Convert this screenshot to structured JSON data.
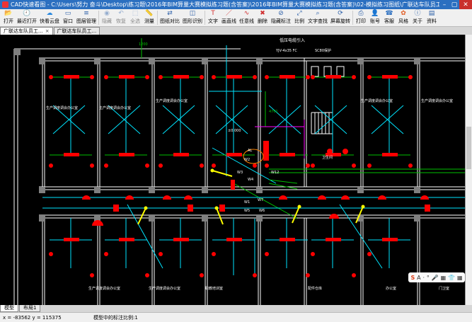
{
  "window": {
    "title": "CAD快速看图 - C:\\Users\\努力 奋斗\\Desktop\\练习题\\2016年BIM算量大赛模拟练习题(含答案)\\2016年BIM算量大赛模拟练习题(含答案)\\02-模拟练习图纸\\广联达车队员工宿舍楼--安装--CAD最终版\\广联达..."
  },
  "toolbar": {
    "items": [
      {
        "label": "打开",
        "icon": "folder-icon"
      },
      {
        "label": "最近打开",
        "icon": "clock-icon"
      },
      {
        "label": "快看云盘",
        "icon": "cloud-icon"
      },
      {
        "label": "窗口",
        "icon": "window-icon"
      },
      {
        "label": "图层管理",
        "icon": "layers-icon"
      },
      {
        "label": "隐藏",
        "icon": "eye-icon",
        "disabled": true
      },
      {
        "label": "恢复",
        "icon": "undo-icon",
        "disabled": true
      },
      {
        "label": "全选",
        "icon": "select-all-icon",
        "disabled": true
      },
      {
        "label": "测量",
        "icon": "ruler-icon"
      },
      {
        "label": "图纸对比",
        "icon": "compare-icon"
      },
      {
        "label": "图形识别",
        "icon": "recognize-icon"
      },
      {
        "label": "文字",
        "icon": "text-icon"
      },
      {
        "label": "画直线",
        "icon": "line-icon"
      },
      {
        "label": "任意线",
        "icon": "freehand-icon"
      },
      {
        "label": "删除",
        "icon": "delete-icon"
      },
      {
        "label": "隐藏标注",
        "icon": "hide-mark-icon"
      },
      {
        "label": "比例",
        "icon": "scale-icon"
      },
      {
        "label": "文字查找",
        "icon": "search-text-icon"
      },
      {
        "label": "屏幕旋转",
        "icon": "rotate-icon"
      },
      {
        "label": "打印",
        "icon": "print-icon"
      },
      {
        "label": "账号",
        "icon": "account-icon"
      },
      {
        "label": "客服",
        "icon": "support-icon"
      },
      {
        "label": "风格",
        "icon": "style-icon"
      },
      {
        "label": "关于",
        "icon": "about-icon"
      },
      {
        "label": "资料",
        "icon": "docs-icon"
      }
    ]
  },
  "tabs": [
    {
      "label": "广联达车队员工...",
      "active": true
    },
    {
      "label": "广联达车队员工...",
      "active": false
    }
  ],
  "drawing": {
    "room_labels": [
      "生产调度调会办公室",
      "生产调度调会办公室",
      "生产调度调会办公室",
      "生产调度调会办公室",
      "生产调度调会办公室",
      "生产调度调会办公室",
      "生产调度调会办公室",
      "生产调度调会办公室",
      "职教培训室",
      "配件仓库",
      "办公室",
      "门卫室",
      "卫生间"
    ],
    "elev_label": "±0.000",
    "cable_label": "YJV-4x35 FC",
    "cable_label2": "SC80保护",
    "incoming_label": "低压电缆引入",
    "dim_top": "1200",
    "dim_right": "4761",
    "wire_labels": [
      "W1",
      "W2",
      "W3",
      "W4",
      "W5",
      "W6",
      "W7",
      "W12",
      "AL"
    ]
  },
  "floatbar": {
    "logo": "S",
    "lang": "A",
    "items": [
      "·",
      "°",
      "🎤",
      "▦",
      "👕",
      "▦"
    ]
  },
  "model_tabs": [
    {
      "label": "模型",
      "active": true
    },
    {
      "label": "布局1",
      "active": false
    }
  ],
  "status": {
    "coords": "x = -83562   y = 115375",
    "scale": "模型中的标注比例:1"
  },
  "colors": {
    "wall": "#ffffff",
    "column": "#808080",
    "fixture": "#ff0000",
    "wire": "#00e5ff",
    "wire_green": "#00c000",
    "arrow": "#ffff00",
    "magenta": "#ff00ff"
  }
}
